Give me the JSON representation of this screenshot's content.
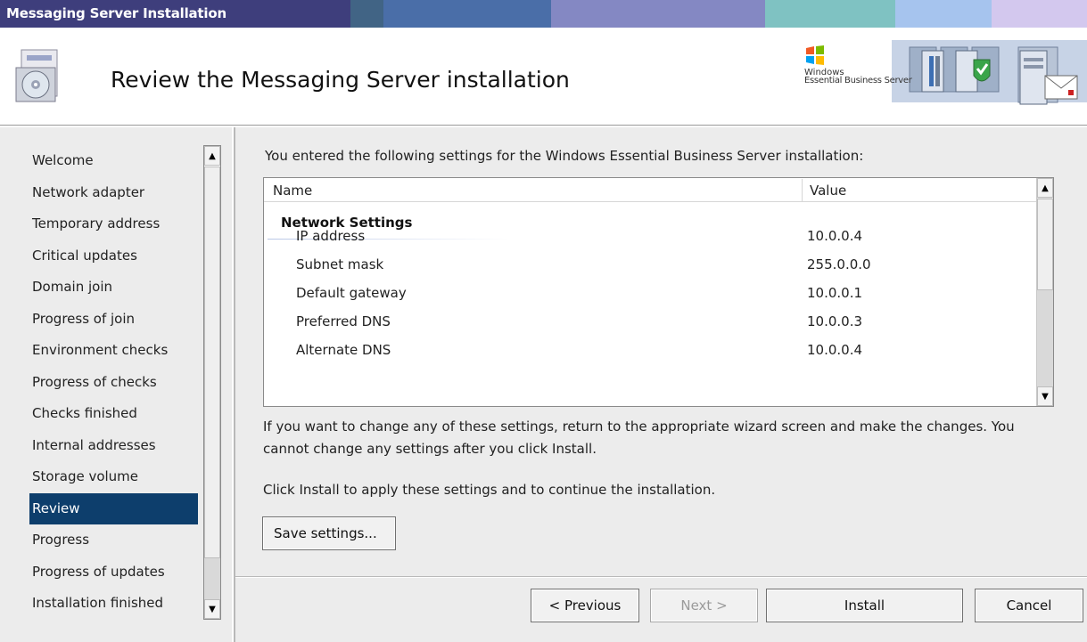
{
  "window": {
    "title": "Messaging Server Installation"
  },
  "titlebar_colors": [
    "#3e3e7c",
    "#416485",
    "#4a6ea8",
    "#8488c3",
    "#7fc2c2",
    "#a6c4ee",
    "#d3c8ee"
  ],
  "header": {
    "title": "Review the Messaging Server installation",
    "icon": "installer-disc-icon",
    "brand_line1": "Windows",
    "brand_line2": "Essential Business Server",
    "brand_icons": [
      "windows-logo-icon",
      "server-tools-icon",
      "server-shield-icon",
      "server-mail-icon"
    ]
  },
  "sidebar": {
    "items": [
      {
        "label": "Welcome",
        "selected": false
      },
      {
        "label": "Network adapter",
        "selected": false
      },
      {
        "label": "Temporary address",
        "selected": false
      },
      {
        "label": "Critical updates",
        "selected": false
      },
      {
        "label": "Domain join",
        "selected": false
      },
      {
        "label": "Progress of join",
        "selected": false
      },
      {
        "label": "Environment checks",
        "selected": false
      },
      {
        "label": "Progress of checks",
        "selected": false
      },
      {
        "label": "Checks finished",
        "selected": false
      },
      {
        "label": "Internal addresses",
        "selected": false
      },
      {
        "label": "Storage volume",
        "selected": false
      },
      {
        "label": "Review",
        "selected": true
      },
      {
        "label": "Progress",
        "selected": false
      },
      {
        "label": "Progress of updates",
        "selected": false
      },
      {
        "label": "Installation finished",
        "selected": false
      }
    ],
    "selected_color": "#0d3e6c"
  },
  "main": {
    "intro": "You entered the following settings for the Windows Essential Business Server installation:",
    "table": {
      "col_name": "Name",
      "col_value": "Value",
      "section": "Network Settings",
      "rows": [
        {
          "name": "IP address",
          "value": "10.0.0.4"
        },
        {
          "name": "Subnet mask",
          "value": "255.0.0.0"
        },
        {
          "name": "Default gateway",
          "value": "10.0.0.1"
        },
        {
          "name": "Preferred DNS",
          "value": "10.0.0.3"
        },
        {
          "name": "Alternate DNS",
          "value": "10.0.0.4"
        }
      ]
    },
    "note1": "If you want to change any of these settings, return to the appropriate wizard screen and make the changes. You cannot change any settings after you click Install.",
    "note2": "Click Install to apply these settings and to continue the installation.",
    "save_label": "Save settings..."
  },
  "footer": {
    "previous_label": "< Previous",
    "next_label": "Next >",
    "install_label": "Install",
    "cancel_label": "Cancel"
  }
}
